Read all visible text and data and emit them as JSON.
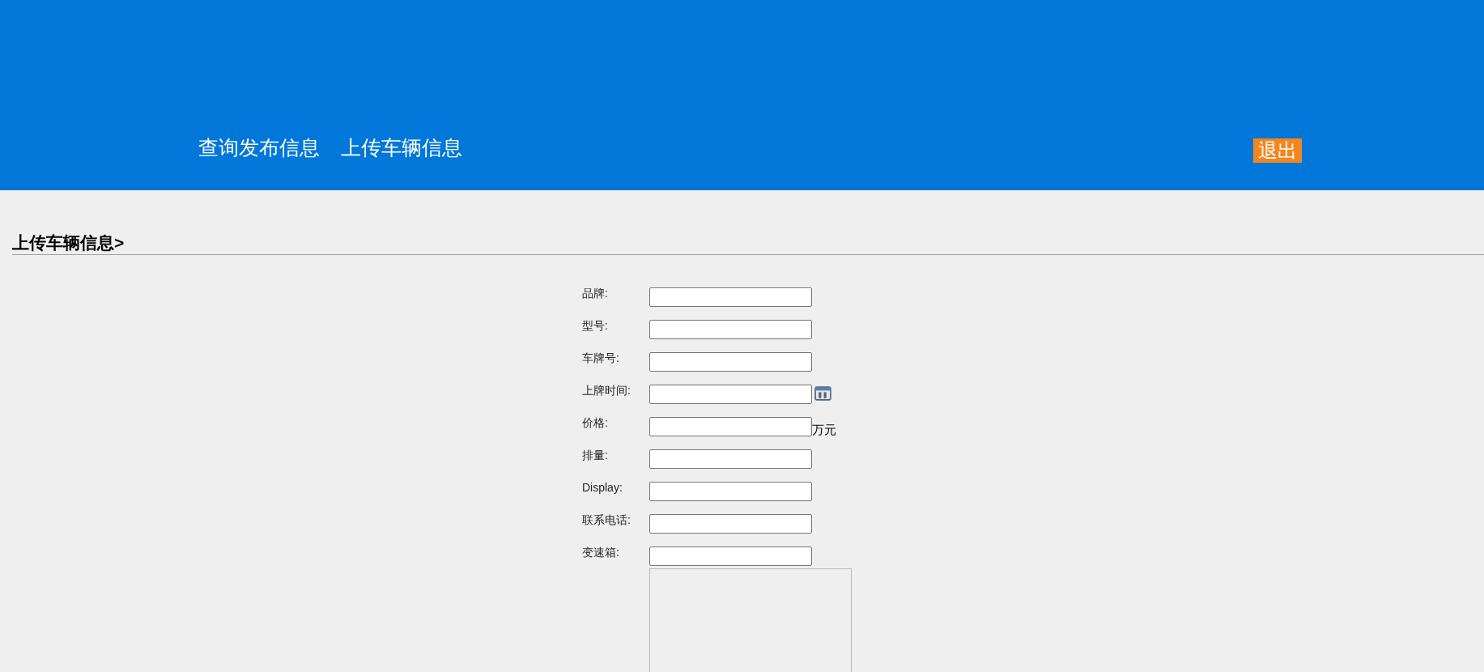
{
  "nav": [
    {
      "label": "查询发布信息"
    },
    {
      "label": "上传车辆信息"
    }
  ],
  "logout_button": {
    "label": "退出"
  },
  "section_title": "上传车辆信息>",
  "form": {
    "fields": [
      {
        "label": "品牌:",
        "kind": "text"
      },
      {
        "label": "型号:",
        "kind": "text"
      },
      {
        "label": "车牌号:",
        "kind": "text"
      },
      {
        "label": "上牌时间:",
        "kind": "date"
      },
      {
        "label": "价格:",
        "kind": "unit",
        "unit": "万元"
      },
      {
        "label": "排量:",
        "kind": "text"
      },
      {
        "label": "Display:",
        "kind": "text"
      },
      {
        "label": "联系电话:",
        "kind": "text"
      },
      {
        "label": "变速箱:",
        "kind": "text"
      },
      {
        "kind": "textarea"
      }
    ]
  }
}
